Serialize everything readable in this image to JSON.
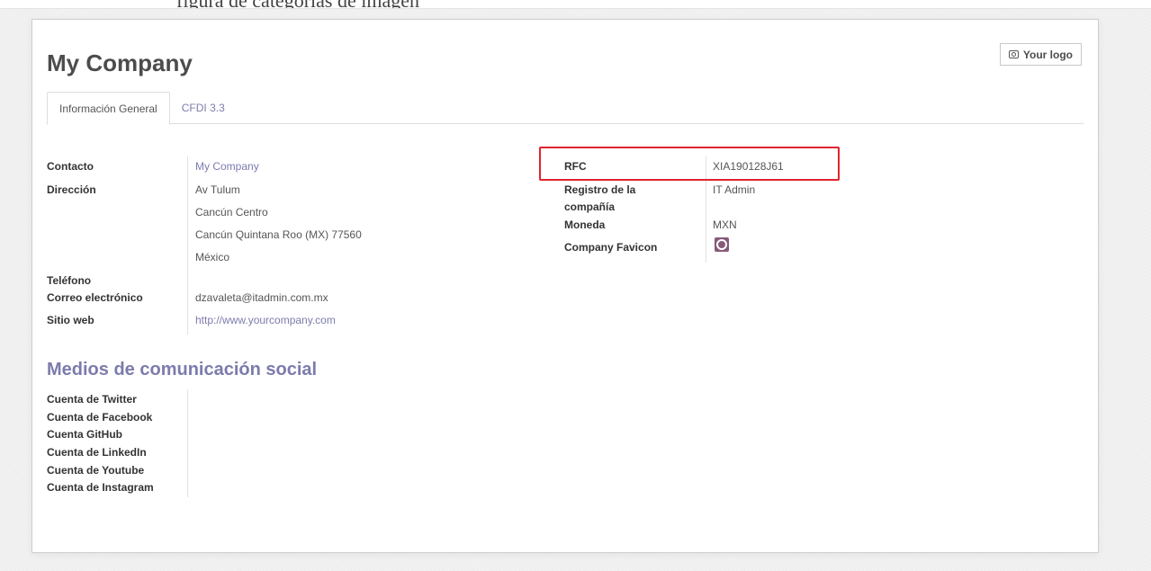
{
  "page_caption": "figura de categorías de imagen",
  "form": {
    "title": "My Company",
    "logo_button": "Your logo",
    "tabs": [
      "Información General",
      "CFDI 3.3"
    ]
  },
  "left": {
    "contacto_label": "Contacto",
    "contacto_value": "My Company",
    "direccion_label": "Dirección",
    "street": "Av Tulum",
    "street2": "Cancún Centro",
    "city_line": "Cancún  Quintana Roo (MX)  77560",
    "country": "México",
    "telefono_label": "Teléfono",
    "correo_label": "Correo electrónico",
    "correo_value": "dzavaleta@itadmin.com.mx",
    "sitio_label": "Sitio web",
    "sitio_value": "http://www.yourcompany.com"
  },
  "right": {
    "rfc_label": "RFC",
    "rfc_value": "XIA190128J61",
    "registro_label_1": "Registro de la",
    "registro_label_2": "compañía",
    "registro_value": "IT Admin",
    "moneda_label": "Moneda",
    "moneda_value": "MXN",
    "favicon_label": "Company Favicon"
  },
  "social": {
    "title": "Medios de comunicación social",
    "items": [
      "Cuenta de Twitter",
      "Cuenta de Facebook",
      "Cuenta GitHub",
      "Cuenta de LinkedIn",
      "Cuenta de Youtube",
      "Cuenta de Instagram"
    ]
  },
  "colors": {
    "link": "#7c7bad",
    "highlight": "#e0232e",
    "favicon": "#875a7b"
  },
  "icons": [
    "camera-icon",
    "company-favicon-icon"
  ]
}
